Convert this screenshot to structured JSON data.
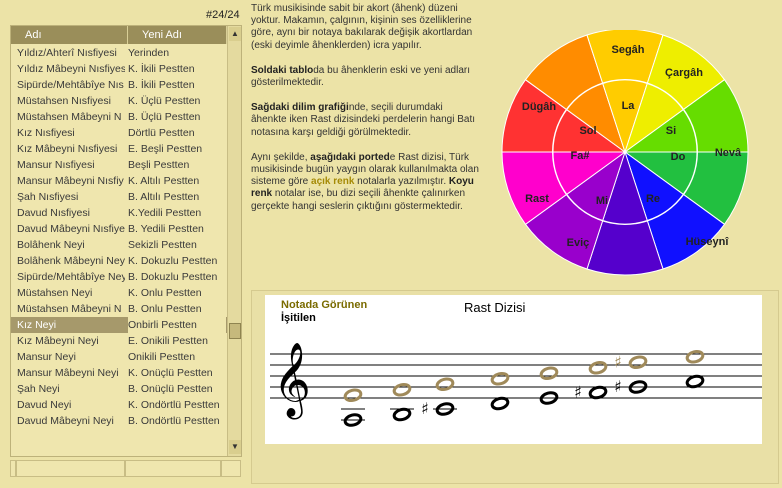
{
  "counter": "#24/24",
  "table": {
    "col1_header": "Adı",
    "col2_header": "Yeni Adı",
    "rows": [
      {
        "name": "Yıldız/Ahterî Nısfiyesi",
        "new": "Yerinden"
      },
      {
        "name": "Yıldız Mâbeyni Nısfiyes",
        "new": "K. İkili Pestten"
      },
      {
        "name": "Sipürde/Mehtâbîye Nıs",
        "new": "B. İkili Pestten"
      },
      {
        "name": "Müstahsen Nısfiyesi",
        "new": "K. Üçlü Pestten"
      },
      {
        "name": "Müstahsen Mâbeyni N",
        "new": "B. Üçlü Pestten"
      },
      {
        "name": "Kız Nısfiyesi",
        "new": "Dörtlü Pestten"
      },
      {
        "name": "Kız Mâbeyni Nısfiyesi",
        "new": "E. Beşli Pestten"
      },
      {
        "name": "Mansur Nısfiyesi",
        "new": "Beşli Pestten"
      },
      {
        "name": "Mansur Mâbeyni Nısfiy",
        "new": "K. Altılı Pestten"
      },
      {
        "name": "Şah Nısfiyesi",
        "new": "B. Altılı Pestten"
      },
      {
        "name": "Davud Nısfiyesi",
        "new": "K.Yedili Pestten"
      },
      {
        "name": "Davud Mâbeyni Nısfiye",
        "new": "B. Yedili Pestten"
      },
      {
        "name": "Bolâhenk Neyi",
        "new": "Sekizli Pestten"
      },
      {
        "name": "Bolâhenk Mâbeyni Ney",
        "new": "K. Dokuzlu Pestten"
      },
      {
        "name": "Sipürde/Mehtâbîye Ney",
        "new": "B. Dokuzlu Pestten"
      },
      {
        "name": "Müstahsen Neyi",
        "new": "K. Onlu Pestten"
      },
      {
        "name": "Müstahsen Mâbeyni N",
        "new": "B. Onlu Pestten"
      },
      {
        "name": "Kız Neyi",
        "new": "Onbirli Pestten"
      },
      {
        "name": "Kız Mâbeyni Neyi",
        "new": "E. Onikili Pestten"
      },
      {
        "name": "Mansur Neyi",
        "new": "Onikili Pestten"
      },
      {
        "name": "Mansur Mâbeyni Neyi",
        "new": "K. Onüçlü Pestten"
      },
      {
        "name": "Şah Neyi",
        "new": "B. Onüçlü Pestten"
      },
      {
        "name": "Davud Neyi",
        "new": "K. Ondörtlü Pestten"
      },
      {
        "name": "Davud Mâbeyni Neyi",
        "new": "B. Ondörtlü Pestten"
      }
    ],
    "selected_index": 17
  },
  "description": {
    "p1": "Türk musikisinde sabit bir akort (âhenk) düzeni yoktur. Makamın, çalgının, kişinin ses özelliklerine göre, aynı bir notaya bakılarak değişik akortlardan (eski deyimle âhenklerden) icra yapılır.",
    "p2_bold": "Soldaki tablo",
    "p2_rest": "da bu âhenklerin eski ve yeni adları gösterilmektedir.",
    "p3_bold": "Sağdaki dilim grafiği",
    "p3_rest": "nde, seçili durumdaki âhenkte iken Rast dizisindeki perdelerin hangi Batı notasına karşı geldiği görülmektedir.",
    "p4_a": "Aynı şekilde, ",
    "p4_bold1": "aşağıdaki ported",
    "p4_b": "e Rast dizisi, Türk musikisinde bugün yaygın olarak kullanılmakta olan sisteme göre ",
    "p4_light": "açık renk",
    "p4_c": " notalarla yazılmıştır. ",
    "p4_bold2": "Koyu renk",
    "p4_d": " notalar ise, bu dizi seçili âhenkte çalınırken gerçekte hangi seslerin çıktığını göstermektedir."
  },
  "wheel": {
    "colors": [
      "#ff3232",
      "#ff8c00",
      "#ffcc00",
      "#eeee00",
      "#66dd00",
      "#22c040",
      "#1010ff",
      "#5500cc",
      "#9900cc",
      "#ff00cc"
    ],
    "outer_labels": [
      "Segâh",
      "Çargâh",
      "Nevâ",
      "Hüseynî",
      "Eviç",
      "Rast",
      "Dügâh"
    ],
    "inner_labels": [
      "La",
      "Si",
      "Do",
      "Re",
      "Mi",
      "Fa#",
      "Sol"
    ]
  },
  "notation": {
    "title": "Rast Dizisi",
    "legend_shown": "Notada Görünen",
    "legend_heard": "İşitilen",
    "shown_color": "#a08a5a",
    "heard_color": "#000000",
    "accent_color": "#7a6b00"
  }
}
